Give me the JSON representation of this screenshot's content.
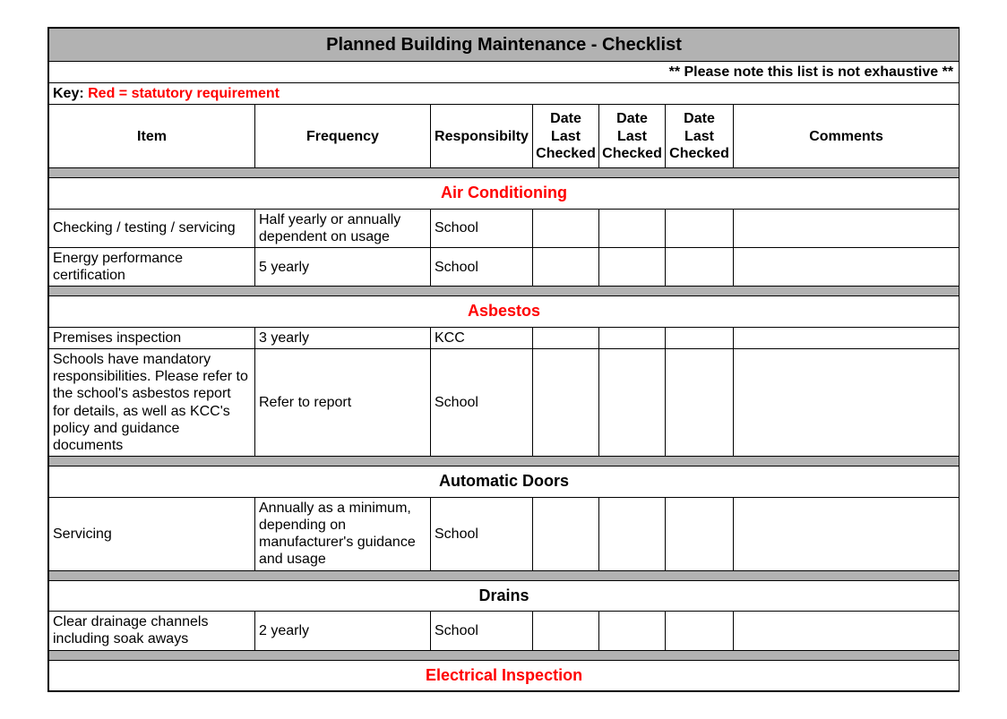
{
  "title": "Planned Building Maintenance - Checklist",
  "note": "** Please note this list is not exhaustive **",
  "key_prefix": "Key:  ",
  "key_text": "Red = statutory requirement",
  "headers": {
    "item": "Item",
    "frequency": "Frequency",
    "responsibility": "Responsibilty",
    "date1": "Date Last Checked",
    "date2": "Date Last Checked",
    "date3": "Date Last Checked",
    "comments": "Comments"
  },
  "sections": [
    {
      "title": "Air Conditioning",
      "statutory": true,
      "rows": [
        {
          "item": "Checking / testing / servicing",
          "frequency": "Half yearly or annually dependent on usage",
          "responsibility": "School",
          "d1": "",
          "d2": "",
          "d3": "",
          "comments": ""
        },
        {
          "item": "Energy performance certification",
          "frequency": "5 yearly",
          "responsibility": "School",
          "d1": "",
          "d2": "",
          "d3": "",
          "comments": ""
        }
      ]
    },
    {
      "title": "Asbestos",
      "statutory": true,
      "rows": [
        {
          "item": "Premises inspection",
          "frequency": "3 yearly",
          "responsibility": "KCC",
          "d1": "",
          "d2": "",
          "d3": "",
          "comments": ""
        },
        {
          "item": "Schools have mandatory responsibilities. Please refer to the school's asbestos report for details, as well as KCC's policy and guidance documents",
          "frequency": "Refer to report",
          "responsibility": "School",
          "d1": "",
          "d2": "",
          "d3": "",
          "comments": ""
        }
      ]
    },
    {
      "title": "Automatic Doors",
      "statutory": false,
      "rows": [
        {
          "item": "Servicing",
          "frequency": "Annually as a minimum, depending on manufacturer's guidance and usage",
          "responsibility": "School",
          "d1": "",
          "d2": "",
          "d3": "",
          "comments": ""
        }
      ]
    },
    {
      "title": "Drains",
      "statutory": false,
      "rows": [
        {
          "item": "Clear drainage channels including soak aways",
          "frequency": "2 yearly",
          "responsibility": "School",
          "d1": "",
          "d2": "",
          "d3": "",
          "comments": ""
        }
      ]
    },
    {
      "title": "Electrical Inspection",
      "statutory": true,
      "rows": []
    }
  ]
}
